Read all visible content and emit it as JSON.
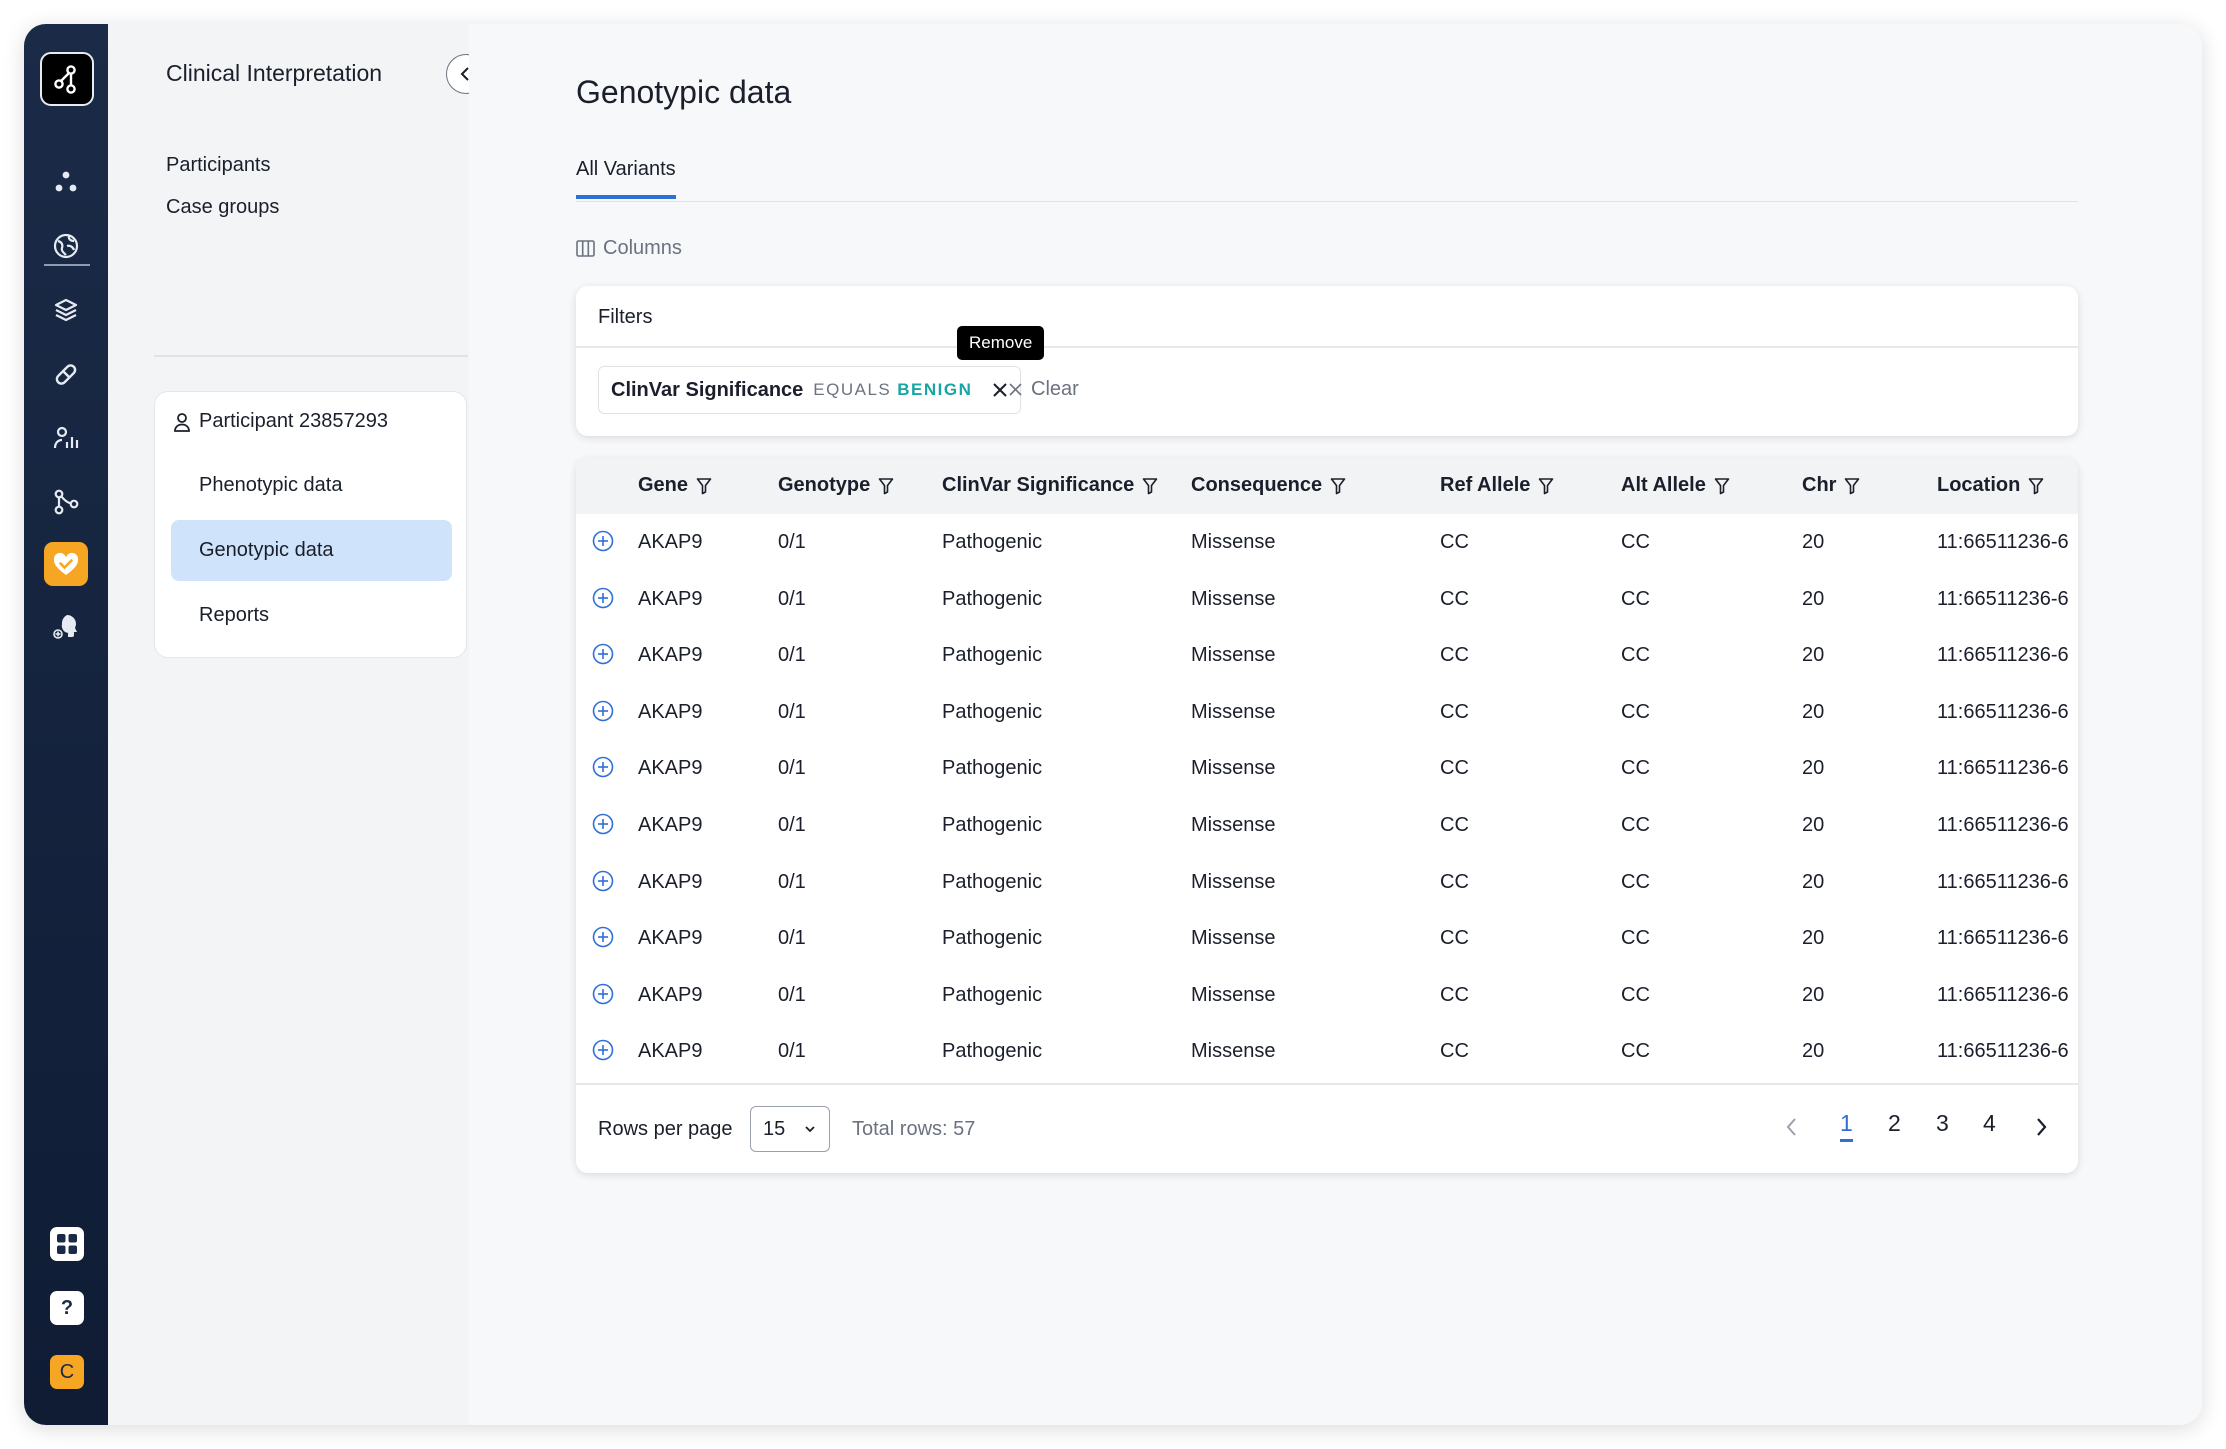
{
  "colors": {
    "rail_bg": "#1b2b47",
    "accent": "#f6a623",
    "primary": "#2f6fd6",
    "selected_bg": "#cfe4fb",
    "benign": "#1aa5a5"
  },
  "rail": {
    "icons": [
      "logo-icon",
      "cluster-icon",
      "globe-icon",
      "layers-icon",
      "pill-icon",
      "analytics-icon",
      "branch-icon",
      "heart-check-icon",
      "head-icon",
      "apps-grid-icon",
      "help-icon"
    ],
    "help_label": "?",
    "avatar_initial": "C"
  },
  "sidenav": {
    "title": "Clinical Interpretation",
    "links": [
      "Participants",
      "Case groups"
    ],
    "participant": {
      "label": "Participant 23857293",
      "items": [
        "Phenotypic data",
        "Genotypic data",
        "Reports"
      ],
      "active_item": "Genotypic data"
    }
  },
  "main": {
    "title": "Genotypic data",
    "tab": "All Variants",
    "columns_label": "Columns",
    "filters": {
      "title": "Filters",
      "chip": {
        "field": "ClinVar Significance",
        "op": "EQUALS",
        "value": "BENIGN"
      },
      "clear_label": "Clear",
      "tooltip": "Remove"
    },
    "table": {
      "columns": [
        "Gene",
        "Genotype",
        "ClinVar Significance",
        "Consequence",
        "Ref Allele",
        "Alt Allele",
        "Chr",
        "Location"
      ],
      "rows": [
        [
          "AKAP9",
          "0/1",
          "Pathogenic",
          "Missense",
          "CC",
          "CC",
          "20",
          "11:66511236-6"
        ],
        [
          "AKAP9",
          "0/1",
          "Pathogenic",
          "Missense",
          "CC",
          "CC",
          "20",
          "11:66511236-6"
        ],
        [
          "AKAP9",
          "0/1",
          "Pathogenic",
          "Missense",
          "CC",
          "CC",
          "20",
          "11:66511236-6"
        ],
        [
          "AKAP9",
          "0/1",
          "Pathogenic",
          "Missense",
          "CC",
          "CC",
          "20",
          "11:66511236-6"
        ],
        [
          "AKAP9",
          "0/1",
          "Pathogenic",
          "Missense",
          "CC",
          "CC",
          "20",
          "11:66511236-6"
        ],
        [
          "AKAP9",
          "0/1",
          "Pathogenic",
          "Missense",
          "CC",
          "CC",
          "20",
          "11:66511236-6"
        ],
        [
          "AKAP9",
          "0/1",
          "Pathogenic",
          "Missense",
          "CC",
          "CC",
          "20",
          "11:66511236-6"
        ],
        [
          "AKAP9",
          "0/1",
          "Pathogenic",
          "Missense",
          "CC",
          "CC",
          "20",
          "11:66511236-6"
        ],
        [
          "AKAP9",
          "0/1",
          "Pathogenic",
          "Missense",
          "CC",
          "CC",
          "20",
          "11:66511236-6"
        ],
        [
          "AKAP9",
          "0/1",
          "Pathogenic",
          "Missense",
          "CC",
          "CC",
          "20",
          "11:66511236-6"
        ]
      ]
    },
    "footer": {
      "rows_per_page_label": "Rows per page",
      "rows_per_page_value": "15",
      "total_label": "Total rows: 57",
      "pages": [
        "1",
        "2",
        "3",
        "4"
      ],
      "current_page": "1"
    }
  }
}
